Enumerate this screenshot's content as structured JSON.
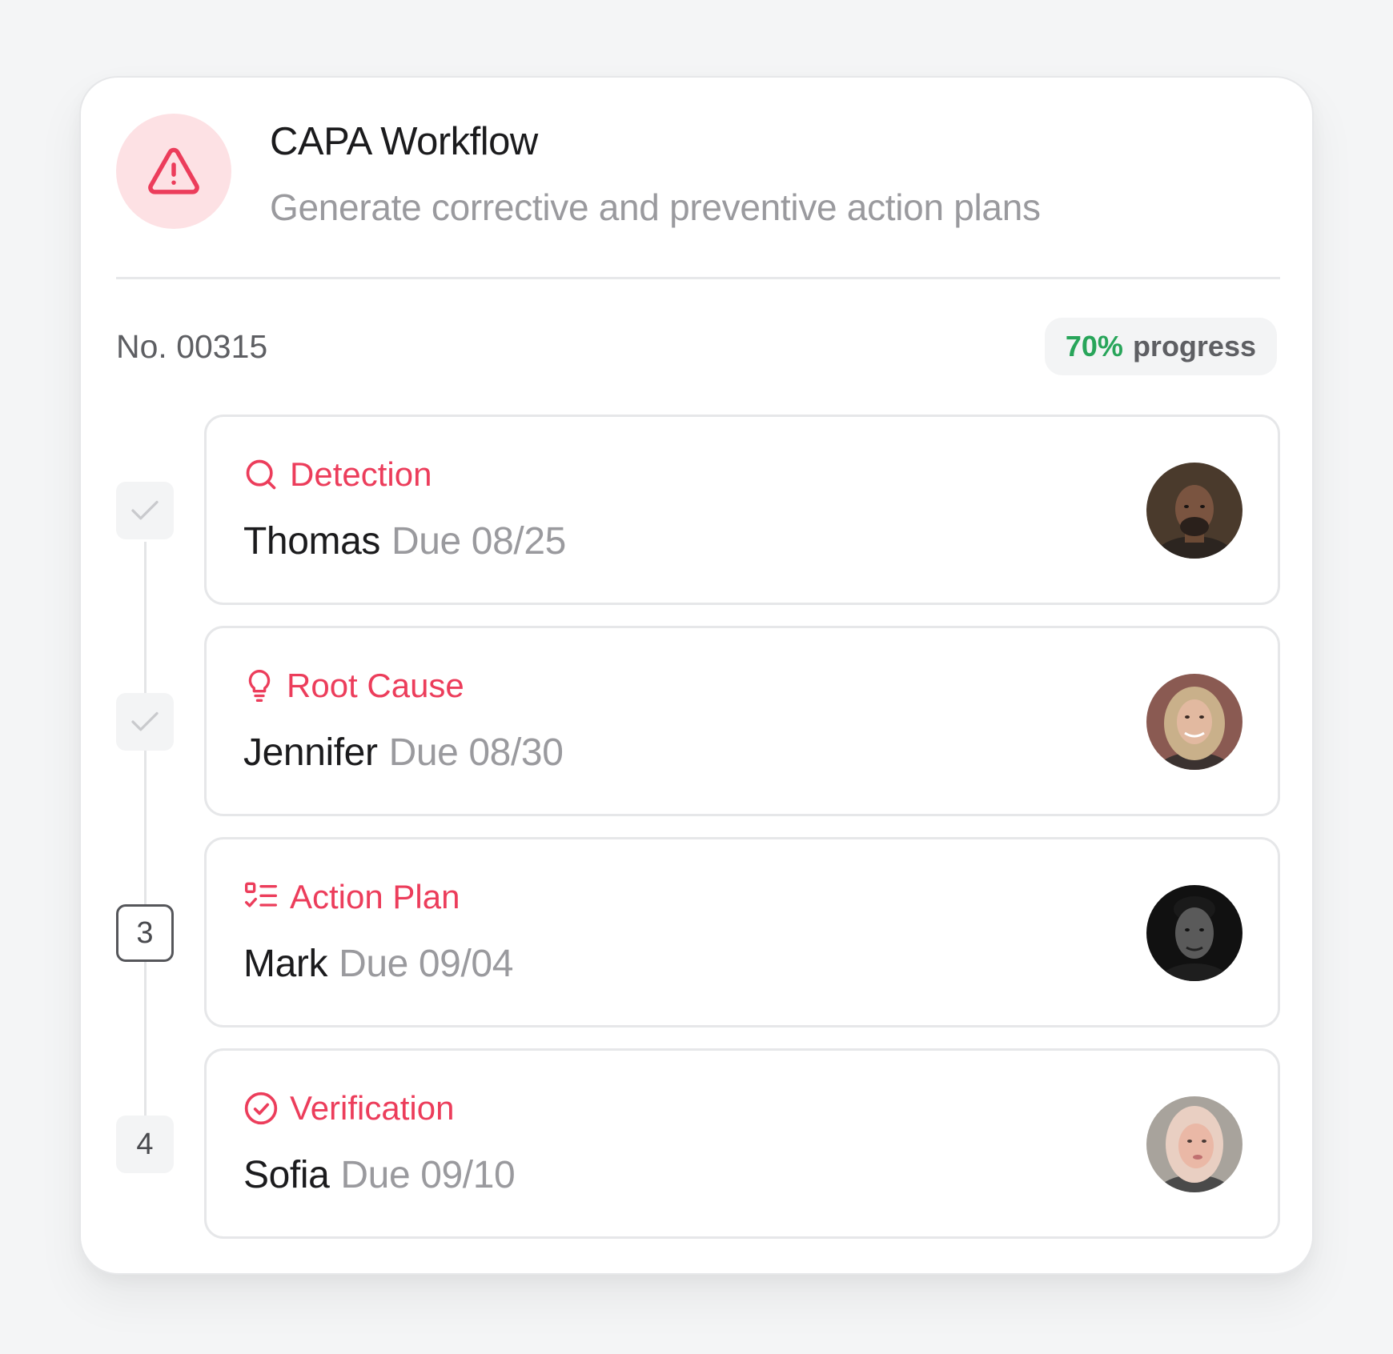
{
  "header": {
    "title": "CAPA Workflow",
    "subtitle": "Generate corrective and preventive action plans",
    "icon": "warning-triangle-icon",
    "accent": "#ec3d5b"
  },
  "case": {
    "number": "No. 00315",
    "progress_value": "70%",
    "progress_label": "progress",
    "progress_color": "#28a55a"
  },
  "steps": [
    {
      "marker": "",
      "status": "done",
      "icon": "search-icon",
      "title": "Detection",
      "assignee": "Thomas",
      "due": "Due 08/25"
    },
    {
      "marker": "",
      "status": "done",
      "icon": "lightbulb-icon",
      "title": "Root Cause",
      "assignee": "Jennifer",
      "due": "Due 08/30"
    },
    {
      "marker": "3",
      "status": "active",
      "icon": "checklist-icon",
      "title": "Action Plan",
      "assignee": "Mark",
      "due": "Due 09/04"
    },
    {
      "marker": "4",
      "status": "pending",
      "icon": "check-circle-icon",
      "title": "Verification",
      "assignee": "Sofia",
      "due": "Due 09/10"
    }
  ]
}
